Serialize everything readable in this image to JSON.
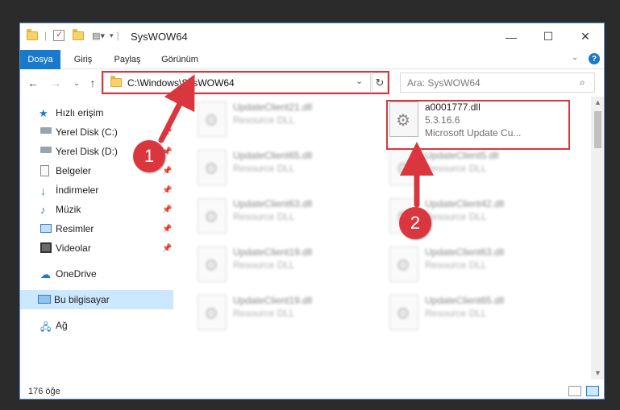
{
  "window": {
    "title": "SysWOW64"
  },
  "ribbon": {
    "tabs": [
      "Dosya",
      "Giriş",
      "Paylaş",
      "Görünüm"
    ]
  },
  "address": {
    "path": "C:\\Windows\\SysWOW64",
    "search_placeholder": "Ara: SysWOW64"
  },
  "sidebar": {
    "items": [
      {
        "label": "Hızlı erişim",
        "icon": "star-icon"
      },
      {
        "label": "Yerel Disk (C:)",
        "icon": "drive-icon"
      },
      {
        "label": "Yerel Disk (D:)",
        "icon": "drive-icon"
      },
      {
        "label": "Belgeler",
        "icon": "documents-icon"
      },
      {
        "label": "İndirmeler",
        "icon": "download-icon"
      },
      {
        "label": "Müzik",
        "icon": "music-icon"
      },
      {
        "label": "Resimler",
        "icon": "pictures-icon"
      },
      {
        "label": "Videolar",
        "icon": "videos-icon"
      },
      {
        "label": "OneDrive",
        "icon": "cloud-icon"
      },
      {
        "label": "Bu bilgisayar",
        "icon": "computer-icon"
      },
      {
        "label": "Ağ",
        "icon": "network-icon"
      }
    ]
  },
  "files": {
    "highlighted": {
      "name": "a0001777.dll",
      "version": "5.3.16.6",
      "description": "Microsoft Update Cu..."
    },
    "blurred": [
      {
        "name": "UpdateClient21.dll",
        "type": "Resource DLL"
      },
      {
        "name": "UpdateClient65.dll",
        "type": "Resource DLL"
      },
      {
        "name": "UpdateClient5.dll",
        "type": "Resource DLL"
      },
      {
        "name": "UpdateClient63.dll",
        "type": "Resource DLL"
      },
      {
        "name": "UpdateClient42.dll",
        "type": "Resource DLL"
      },
      {
        "name": "UpdateClient19.dll",
        "type": "Resource DLL"
      },
      {
        "name": "UpdateClient63.dll",
        "type": "Resource DLL"
      },
      {
        "name": "UpdateClient19.dll",
        "type": "Resource DLL"
      },
      {
        "name": "UpdateClient65.dll",
        "type": "Resource DLL"
      }
    ]
  },
  "status": {
    "count": "176 öğe"
  },
  "annotations": {
    "badge1": "1",
    "badge2": "2"
  },
  "colors": {
    "accent": "#1979ca",
    "annotation_red": "#d9363e"
  }
}
